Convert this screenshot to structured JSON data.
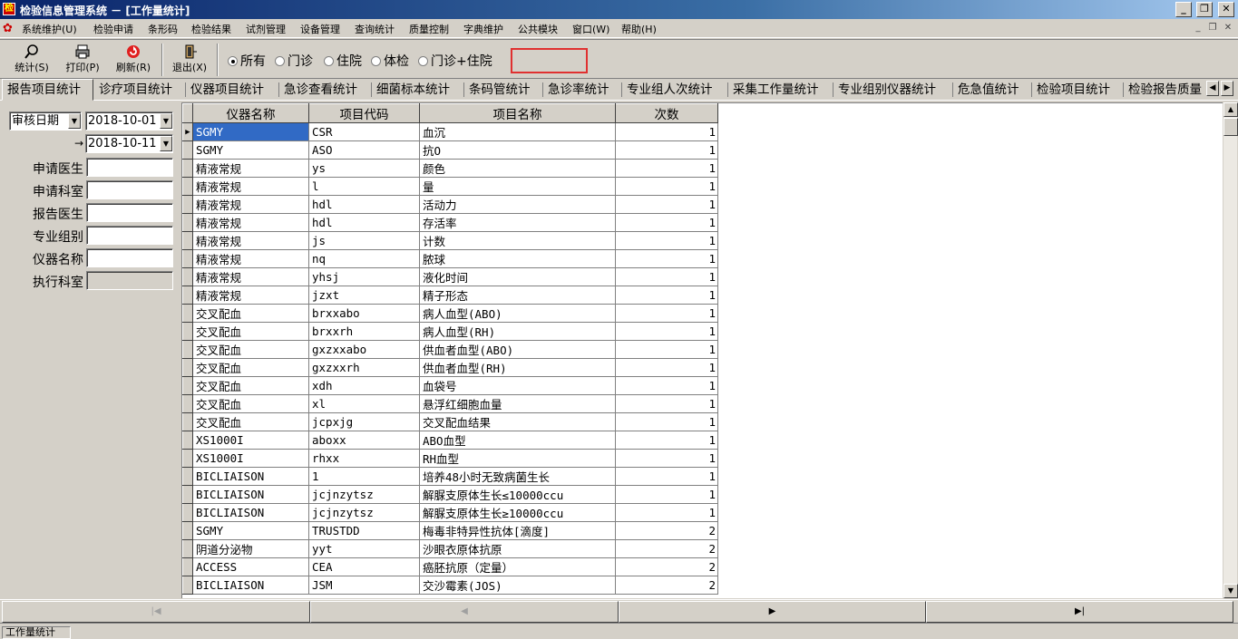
{
  "window": {
    "title": "检验信息管理系统 － [工作量统计]"
  },
  "menu": [
    "系统维护(U)",
    "检验申请",
    "条形码",
    "检验结果",
    "试剂管理",
    "设备管理",
    "查询统计",
    "质量控制",
    "字典维护",
    "公共模块",
    "窗口(W)",
    "帮助(H)"
  ],
  "toolbar": {
    "stat": "统计(S)",
    "print": "打印(P)",
    "refresh": "刷新(R)",
    "exit": "退出(X)",
    "radios": [
      "所有",
      "门诊",
      "住院",
      "体检",
      "门诊+住院"
    ],
    "selected_radio": "所有"
  },
  "tabs": [
    "报告项目统计",
    "诊疗项目统计",
    "仪器项目统计",
    "急诊查看统计",
    "细菌标本统计",
    "条码管统计",
    "急诊率统计",
    "专业组人次统计",
    "采集工作量统计",
    "专业组别仪器统计",
    "危急值统计",
    "检验项目统计",
    "检验报告质量"
  ],
  "active_tab": "报告项目统计",
  "filters": {
    "date_type": "审核日期",
    "date_from": "2018-10-01",
    "date_to_arrow": "→",
    "date_to": "2018-10-11",
    "labels": {
      "apply_doctor": "申请医生",
      "apply_dept": "申请科室",
      "report_doctor": "报告医生",
      "group": "专业组别",
      "instrument": "仪器名称",
      "exec_dept": "执行科室"
    }
  },
  "grid": {
    "columns": [
      "仪器名称",
      "项目代码",
      "项目名称",
      "次数"
    ],
    "rows": [
      [
        "SGMY",
        "CSR",
        "血沉",
        "1"
      ],
      [
        "SGMY",
        "ASO",
        "抗O",
        "1"
      ],
      [
        "精液常规",
        "ys",
        "颜色",
        "1"
      ],
      [
        "精液常规",
        "l",
        "量",
        "1"
      ],
      [
        "精液常规",
        "hdl",
        "活动力",
        "1"
      ],
      [
        "精液常规",
        "hdl",
        "存活率",
        "1"
      ],
      [
        "精液常规",
        "js",
        "计数",
        "1"
      ],
      [
        "精液常规",
        "nq",
        "脓球",
        "1"
      ],
      [
        "精液常规",
        "yhsj",
        "液化时间",
        "1"
      ],
      [
        "精液常规",
        "jzxt",
        "精子形态",
        "1"
      ],
      [
        "交叉配血",
        "brxxabo",
        "病人血型(ABO)",
        "1"
      ],
      [
        "交叉配血",
        "brxxrh",
        "病人血型(RH)",
        "1"
      ],
      [
        "交叉配血",
        "gxzxxabo",
        "供血者血型(ABO)",
        "1"
      ],
      [
        "交叉配血",
        "gxzxxrh",
        "供血者血型(RH)",
        "1"
      ],
      [
        "交叉配血",
        "xdh",
        "血袋号",
        "1"
      ],
      [
        "交叉配血",
        "xl",
        "悬浮红细胞血量",
        "1"
      ],
      [
        "交叉配血",
        "jcpxjg",
        "交叉配血结果",
        "1"
      ],
      [
        "XS1000I",
        "aboxx",
        "ABO血型",
        "1"
      ],
      [
        "XS1000I",
        "rhxx",
        "RH血型",
        "1"
      ],
      [
        "BICLIAISON",
        "1",
        "培养48小时无致病菌生长",
        "1"
      ],
      [
        "BICLIAISON",
        "jcjnzytsz",
        "解脲支原体生长≤10000ccu",
        "1"
      ],
      [
        "BICLIAISON",
        "jcjnzytsz",
        "解脲支原体生长≥10000ccu",
        "1"
      ],
      [
        "SGMY",
        "TRUSTDD",
        "梅毒非特异性抗体[滴度]",
        "2"
      ],
      [
        "阴道分泌物",
        "yyt",
        "沙眼衣原体抗原",
        "2"
      ],
      [
        "ACCESS",
        "CEA",
        "癌胚抗原（定量）",
        "2"
      ],
      [
        "BICLIAISON",
        "JSM",
        "交沙霉素(JOS)",
        "2"
      ]
    ]
  },
  "statusbar": {
    "pane": "工作量统计"
  }
}
